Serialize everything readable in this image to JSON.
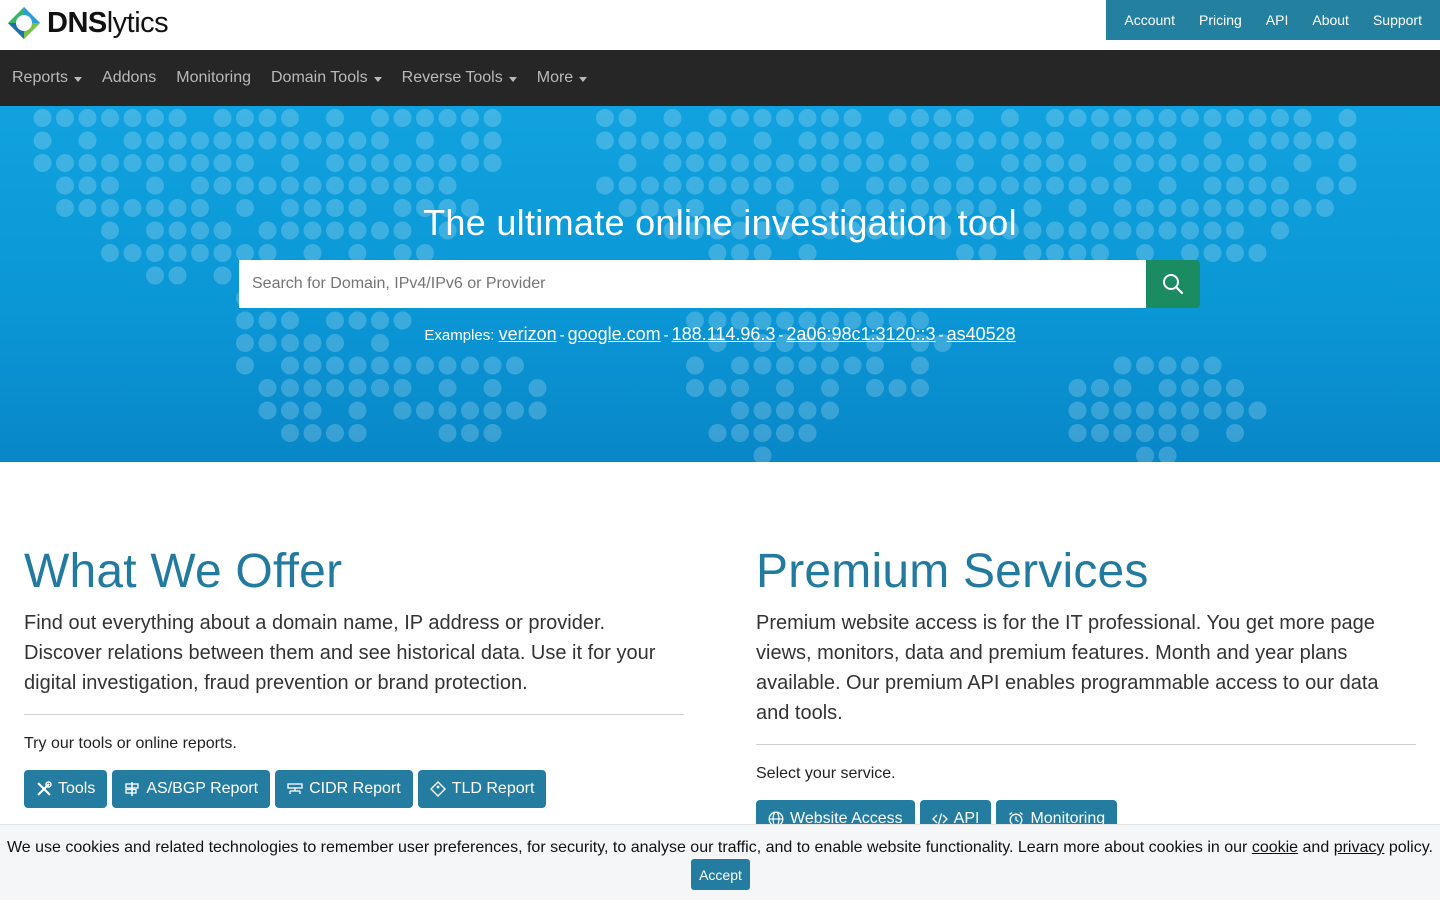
{
  "brand": {
    "name_bold": "DNS",
    "name_rest": "lytics"
  },
  "account_nav": [
    "Account",
    "Pricing",
    "API",
    "About",
    "Support"
  ],
  "main_nav": [
    {
      "label": "Reports",
      "dropdown": true
    },
    {
      "label": "Addons",
      "dropdown": false
    },
    {
      "label": "Monitoring",
      "dropdown": false
    },
    {
      "label": "Domain Tools",
      "dropdown": true
    },
    {
      "label": "Reverse Tools",
      "dropdown": true
    },
    {
      "label": "More",
      "dropdown": true
    }
  ],
  "hero": {
    "title": "The ultimate online investigation tool",
    "search_placeholder": "Search for Domain, IPv4/IPv6 or Provider",
    "examples_label": "Examples:",
    "examples": [
      "verizon",
      "google.com",
      "188.114.96.3",
      "2a06:98c1:3120::3",
      "as40528"
    ]
  },
  "offer": {
    "title": "What We Offer",
    "text": "Find out everything about a domain name, IP address or provider. Discover relations between them and see historical data. Use it for your digital investigation, fraud prevention or brand protection.",
    "sub": "Try our tools or online reports.",
    "buttons": [
      "Tools",
      "AS/BGP Report",
      "CIDR Report",
      "TLD Report"
    ]
  },
  "premium": {
    "title": "Premium Services",
    "text": "Premium website access is for the IT professional. You get more page views, monitors, data and premium features. Month and year plans available. Our premium API enables programmable access to our data and tools.",
    "sub": "Select your service.",
    "buttons": [
      "Website Access",
      "API",
      "Monitoring"
    ]
  },
  "cookie": {
    "text_before": "We use cookies and related technologies to remember user preferences, for security, to analyse our traffic, and to enable website functionality. Learn more about cookies in our",
    "cookie_link": "cookie",
    "and": "and",
    "privacy_link": "privacy",
    "text_after": "policy.",
    "accept": "Accept"
  },
  "colors": {
    "account_nav_bg": "#24809f",
    "main_nav_bg": "#262626",
    "hero_blue": "#0b97d6",
    "search_button": "#1b8c62",
    "heading_blue": "#227a9f",
    "button_blue": "#247da1"
  },
  "icons": {
    "search_button": "search-icon",
    "offer_buttons": [
      "tools-icon",
      "signpost-icon",
      "cidr-icon",
      "tag-icon"
    ],
    "premium_buttons": [
      "globe-icon",
      "code-icon",
      "alarm-icon"
    ]
  }
}
